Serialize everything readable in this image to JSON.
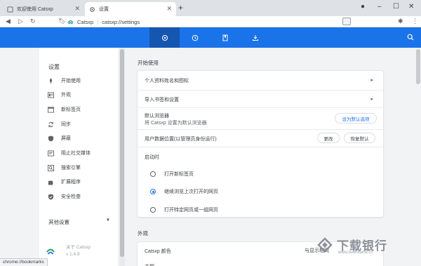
{
  "tabs": [
    {
      "title": "欢迎使用 Catsxp"
    },
    {
      "title": "设置"
    }
  ],
  "toolbar": {
    "brand": "Catsxp",
    "url": "catsxp://settings"
  },
  "header": {
    "active_tab_icon": "gear-icon"
  },
  "sidebar": {
    "title": "设置",
    "items": [
      {
        "label": "开始使用",
        "icon": "rocket-icon"
      },
      {
        "label": "外观",
        "icon": "appearance-icon"
      },
      {
        "label": "新标签页",
        "icon": "new-tab-icon"
      },
      {
        "label": "同步",
        "icon": "sync-icon"
      },
      {
        "label": "屏蔽",
        "icon": "shield-icon"
      },
      {
        "label": "阻止社交媒体",
        "icon": "block-social-icon"
      },
      {
        "label": "搜索引擎",
        "icon": "search-icon"
      },
      {
        "label": "扩展程序",
        "icon": "puzzle-icon"
      },
      {
        "label": "安全检查",
        "icon": "shield-check-icon"
      }
    ],
    "other": "其他设置",
    "about_line1": "关于 Catsxp",
    "about_line2": "v 1.4.9"
  },
  "main": {
    "section1_title": "开始使用",
    "rows": {
      "profile": "个人资料姓名和图标",
      "import": "导入书签和设置",
      "default_browser": "默认浏览器",
      "default_browser_sub": "将 Catsxp 设置为默认浏览器",
      "set_default_btn": "设为默认选项",
      "user_data": "用户数据位置(以管理员身份运行)",
      "change_btn": "更改",
      "restore_btn": "恢复默认",
      "startup": "启动时"
    },
    "radios": [
      {
        "label": "打开新标签页",
        "checked": false
      },
      {
        "label": "继续浏览上次打开的网页",
        "checked": true
      },
      {
        "label": "打开特定网页或一组网页",
        "checked": false
      }
    ],
    "section2_title": "外观",
    "appearance_rows": {
      "color": "Catsxp 颜色",
      "color_value": "与显示相同",
      "next": "主题"
    }
  },
  "status_text": "chrome://bookmarks",
  "watermark": {
    "main": "下载银行",
    "sub": "www.downbank.cn"
  },
  "colors": {
    "accent": "#1a73e8",
    "header_active": "#1557b0"
  }
}
